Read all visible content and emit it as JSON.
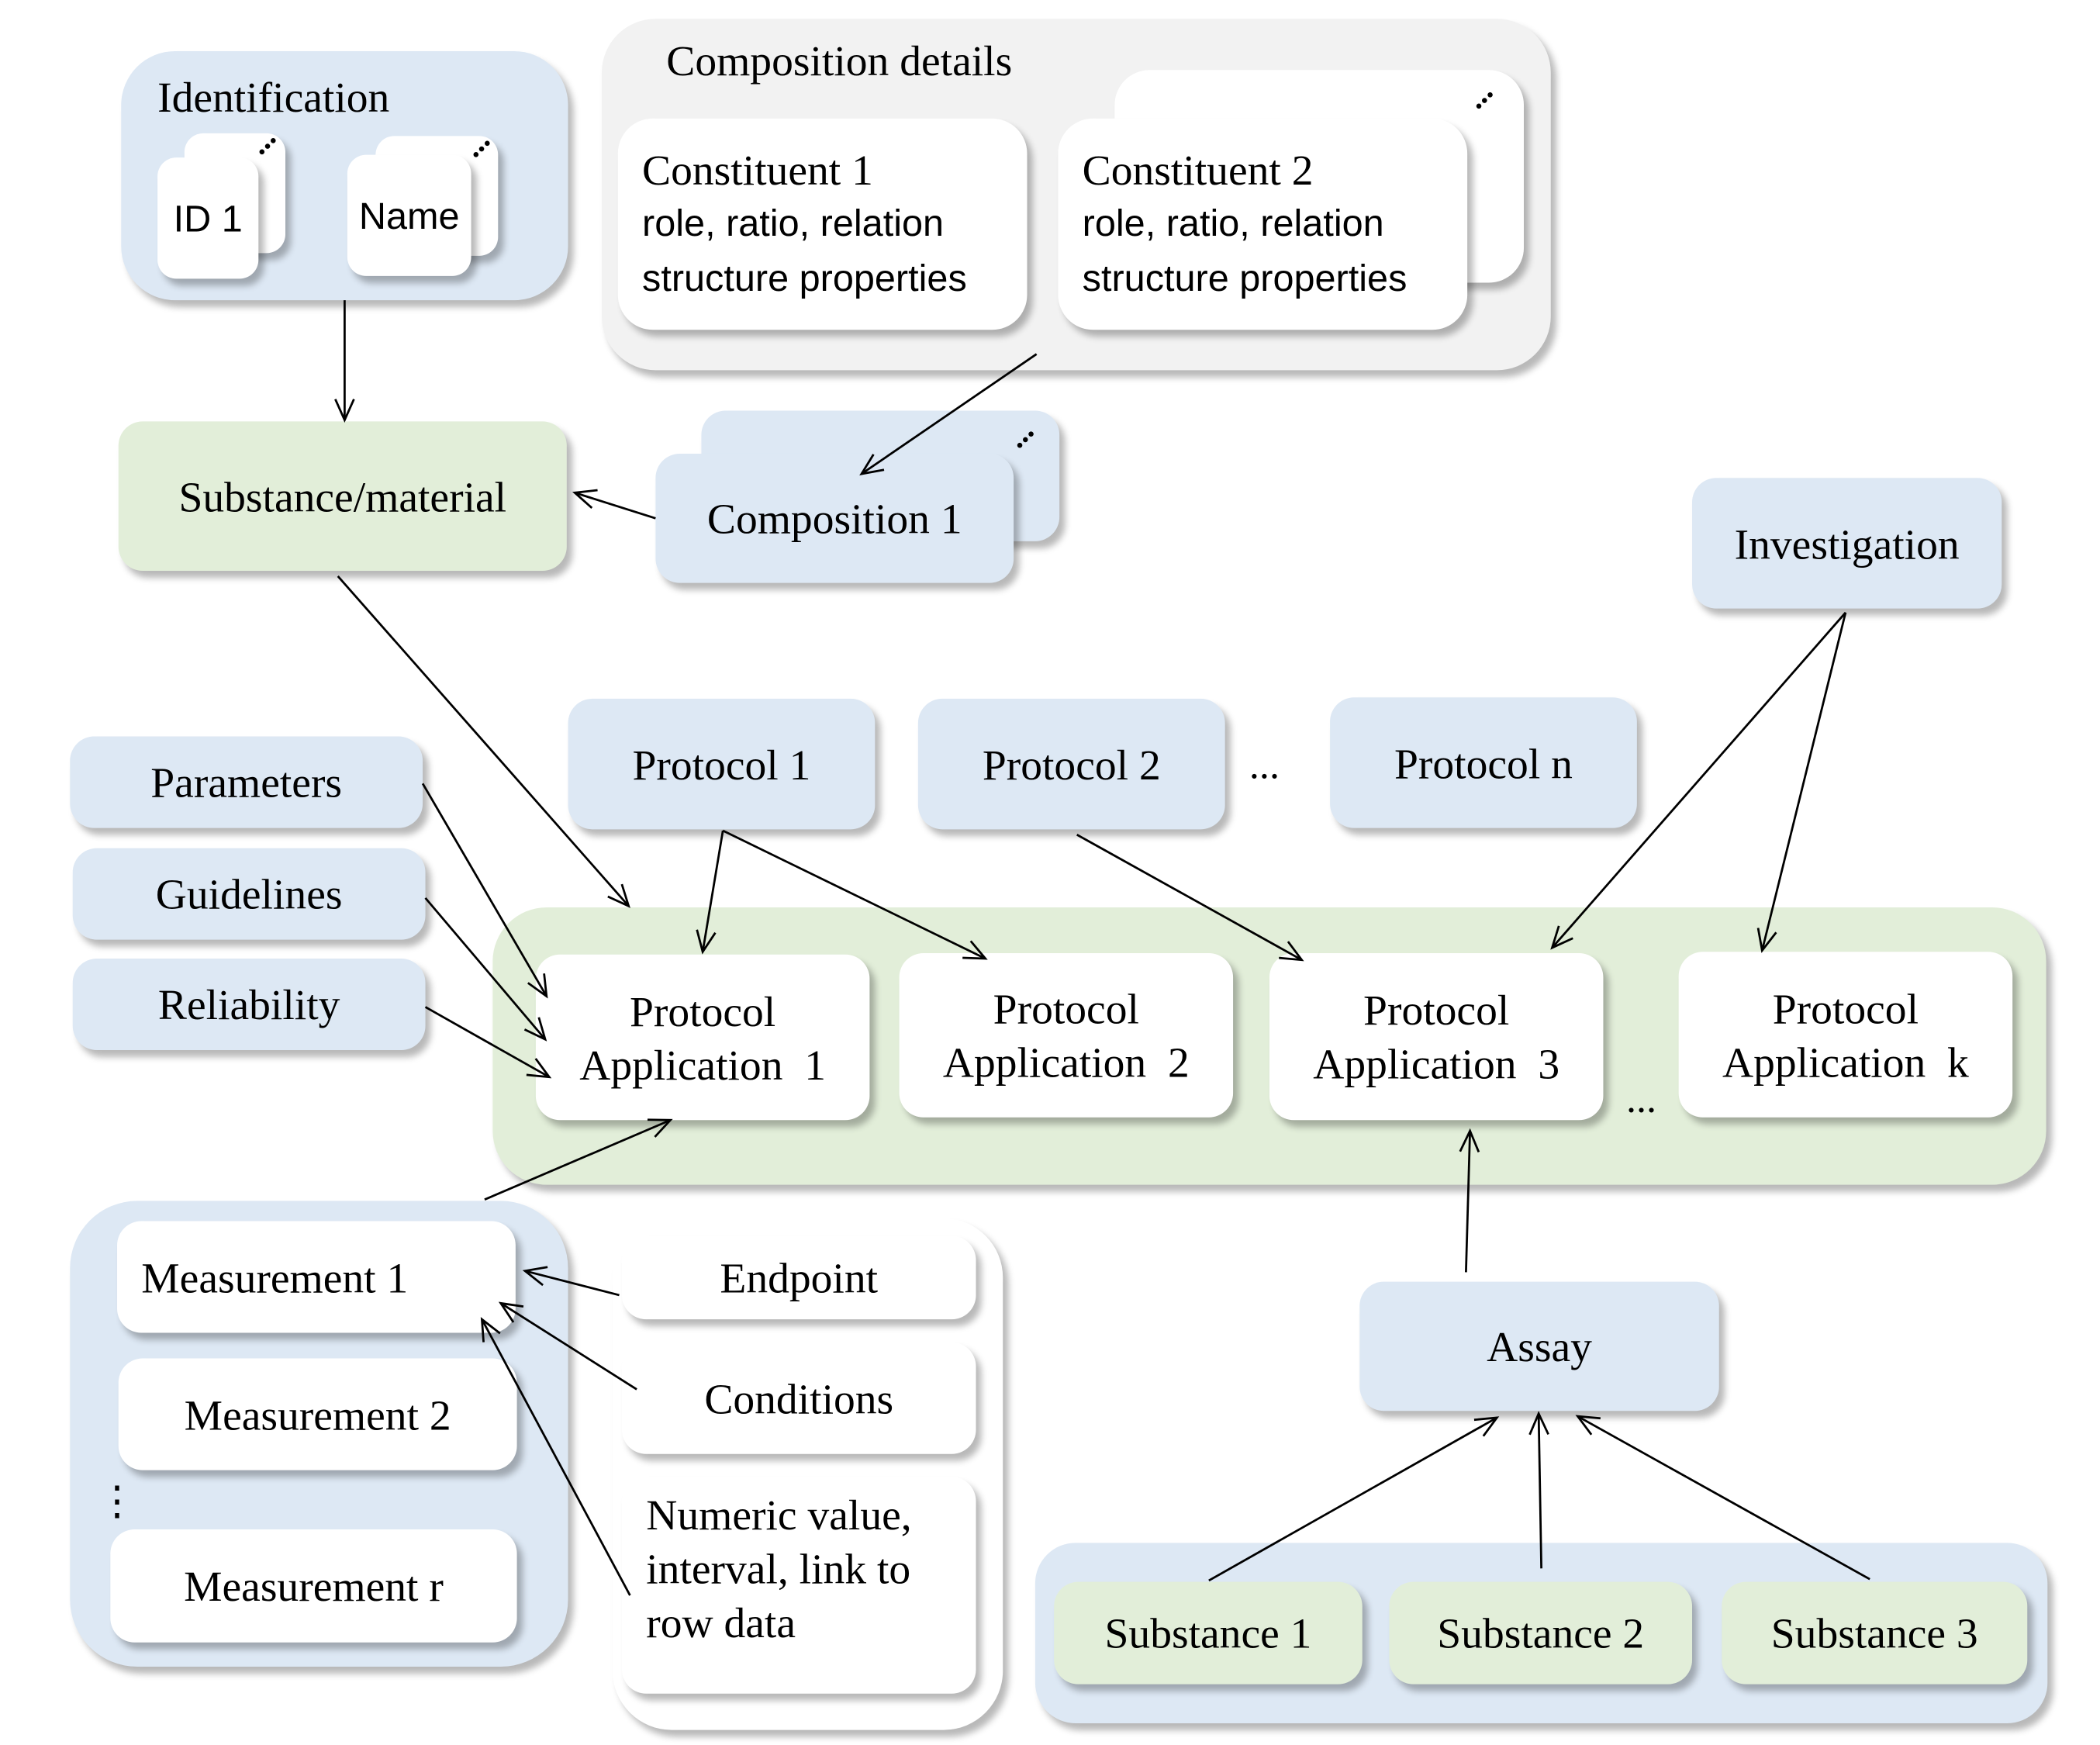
{
  "identification": {
    "title": "Identification",
    "id_label": "ID 1",
    "name_label": "Name"
  },
  "composition_details": {
    "title": "Composition details",
    "constituent1": {
      "title": "Constituent 1",
      "line2": "role, ratio, relation",
      "line3": "structure properties"
    },
    "constituent2": {
      "title": "Constituent 2",
      "line2": "role, ratio, relation",
      "line3": "structure properties"
    }
  },
  "substance_material": "Substance/material",
  "composition": "Composition 1",
  "investigation": "Investigation",
  "side_inputs": [
    "Parameters",
    "Guidelines",
    "Reliability"
  ],
  "protocols": [
    "Protocol 1",
    "Protocol 2",
    "Protocol n"
  ],
  "protocol_ellipsis": "...",
  "protocol_applications": [
    {
      "line1": "Protocol",
      "line2": "Application  1"
    },
    {
      "line1": "Protocol",
      "line2": "Application  2"
    },
    {
      "line1": "Protocol",
      "line2": "Application  3"
    },
    {
      "line1": "Protocol",
      "line2": "Application  k"
    }
  ],
  "application_ellipsis": "...",
  "measurements": [
    "Measurement 1",
    "Measurement 2",
    "Measurement r"
  ],
  "measurement_ellipsis": "⋮",
  "measurement_details": {
    "endpoint": "Endpoint",
    "conditions": "Conditions",
    "value_lines": [
      "Numeric value,",
      "interval, link to",
      "row data"
    ]
  },
  "assay": "Assay",
  "substances": [
    "Substance 1",
    "Substance 2",
    "Substance 3"
  ],
  "colors": {
    "blue": "#dde8f4",
    "green": "#e2eed9",
    "gray": "#f2f2f2"
  }
}
